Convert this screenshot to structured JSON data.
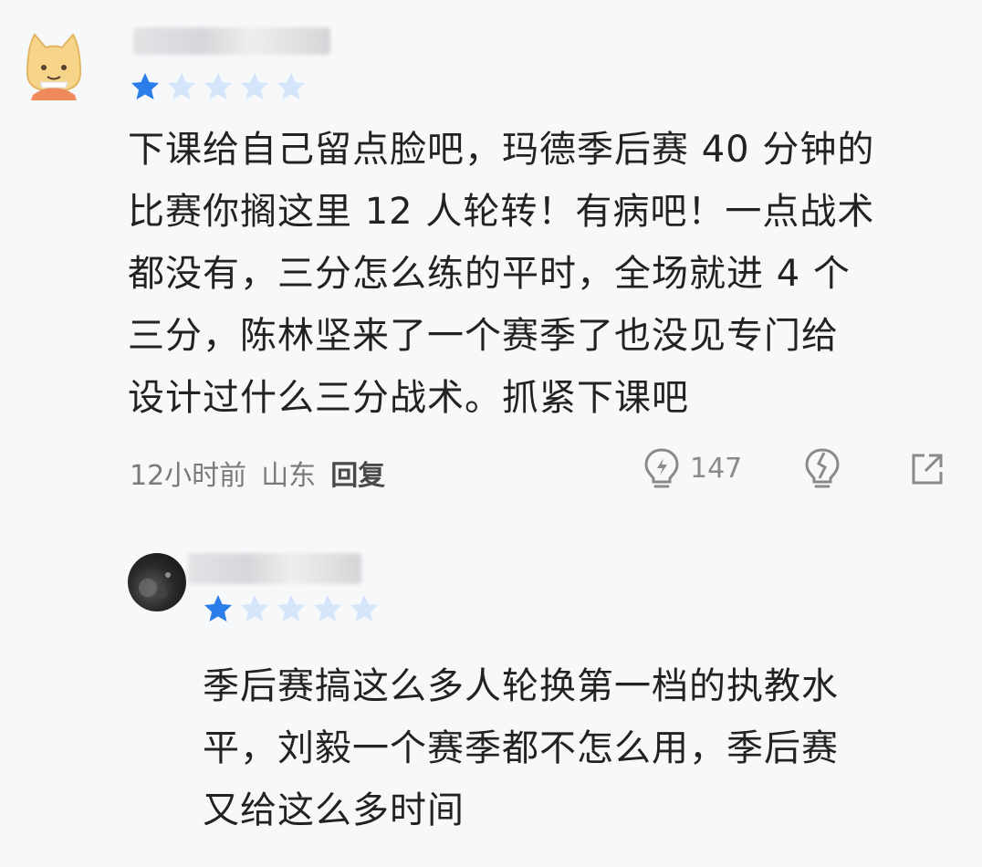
{
  "comments": [
    {
      "avatar": "cat-cartoon-avatar",
      "rating": 1,
      "rating_max": 5,
      "text": "下课给自己留点脸吧，玛德季后赛 40 分钟的\n比赛你搁这里 12 人轮转！有病吧！一点战术\n都没有，三分怎么练的平时，全场就进 4 个\n三分，陈林坚来了一个赛季了也没见专门给\n设计过什么三分战术。抓紧下课吧",
      "time": "12小时前",
      "location": "山东",
      "reply_label": "回复",
      "like_count": "147"
    },
    {
      "avatar": "dark-photo-avatar",
      "rating": 1,
      "rating_max": 5,
      "text": "季后赛搞这么多人轮换第一档的执教水\n平，刘毅一个赛季都不怎么用，季后赛\n又给这么多时间"
    }
  ],
  "colors": {
    "star_active": "#2b7de9",
    "star_inactive": "#d5e6fb",
    "text": "#222222",
    "meta": "#7a7a7a",
    "background": "#f7f8fa"
  }
}
